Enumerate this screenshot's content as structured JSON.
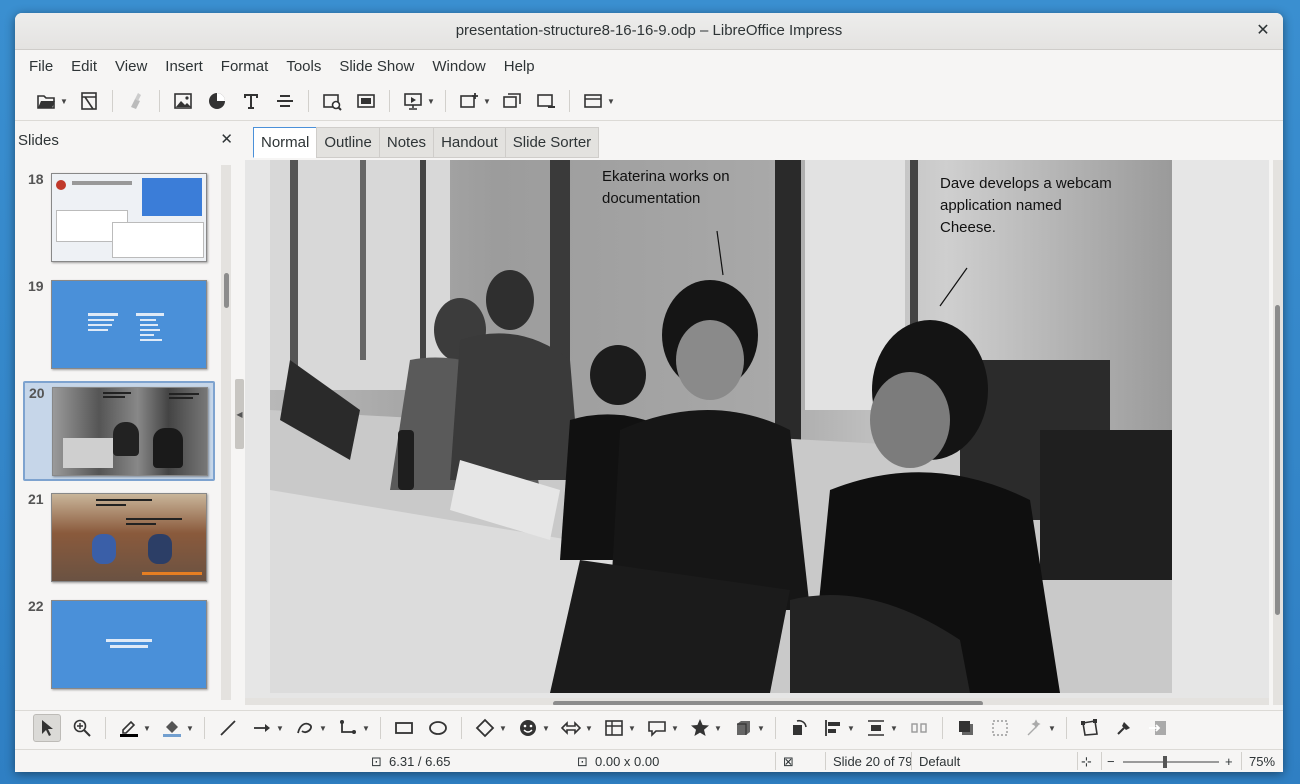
{
  "window": {
    "title": "presentation-structure8-16-16-9.odp – LibreOffice Impress"
  },
  "menu": [
    "File",
    "Edit",
    "View",
    "Insert",
    "Format",
    "Tools",
    "Slide Show",
    "Window",
    "Help"
  ],
  "slides_panel": {
    "title": "Slides",
    "items": [
      {
        "num": "18",
        "theme": "screenshot"
      },
      {
        "num": "19",
        "theme": "blue-text"
      },
      {
        "num": "20",
        "theme": "photo-bw",
        "selected": true
      },
      {
        "num": "21",
        "theme": "photo-color"
      },
      {
        "num": "22",
        "theme": "blue-text"
      }
    ]
  },
  "view_tabs": [
    "Normal",
    "Outline",
    "Notes",
    "Handout",
    "Slide Sorter"
  ],
  "active_tab": "Normal",
  "slide": {
    "caption_left_1": "Ekaterina works on",
    "caption_left_2": "documentation",
    "caption_right_1": "Dave develops a webcam",
    "caption_right_2": "application named",
    "caption_right_3": "Cheese."
  },
  "status": {
    "position": "6.31 / 6.65",
    "size": "0.00 x 0.00",
    "slide_info": "Slide 20 of 79",
    "layout": "Default",
    "zoom": "75%"
  },
  "colors": {
    "accent": "#4a90d9",
    "slide_blue": "#4a90d9"
  }
}
